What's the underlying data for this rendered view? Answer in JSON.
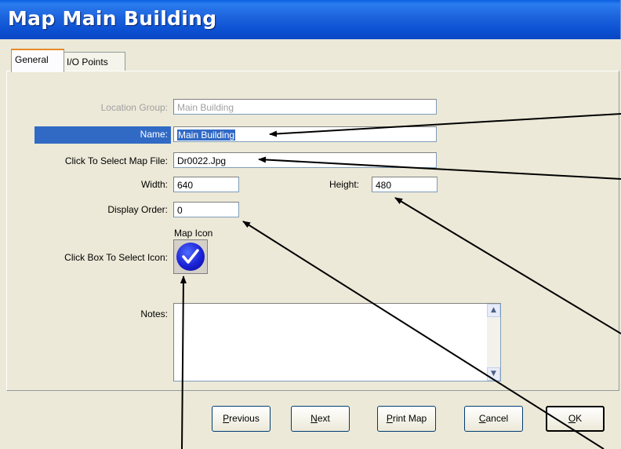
{
  "window": {
    "title": "Map Main Building"
  },
  "tabs": [
    {
      "label": "General",
      "active": true
    },
    {
      "label": "I/O Points",
      "active": false
    }
  ],
  "form": {
    "location_group_label": "Location Group:",
    "location_group_value": "Main Building",
    "name_label": "Name:",
    "name_value": "Main Building",
    "map_file_label": "Click To Select Map File:",
    "map_file_value": "Dr0022.Jpg",
    "width_label": "Width:",
    "width_value": "640",
    "height_label": "Height:",
    "height_value": "480",
    "display_order_label": "Display Order:",
    "display_order_value": "0",
    "map_icon_heading": "Map Icon",
    "icon_label": "Click Box To Select Icon:",
    "icon_name": "checkmark-circle-icon",
    "notes_label": "Notes:",
    "notes_value": ""
  },
  "buttons": {
    "previous": {
      "first": "P",
      "rest": "revious"
    },
    "next": {
      "first": "N",
      "rest": "ext"
    },
    "print_map": {
      "first": "P",
      "rest": "rint Map"
    },
    "cancel": {
      "first": "C",
      "rest": "ancel"
    },
    "ok": {
      "first": "O",
      "rest": "K"
    }
  },
  "colors": {
    "title_bar": "#0b4fd0",
    "selection": "#316ac5",
    "tab_accent": "#e68b2c",
    "icon_blue": "#1a22d6"
  }
}
